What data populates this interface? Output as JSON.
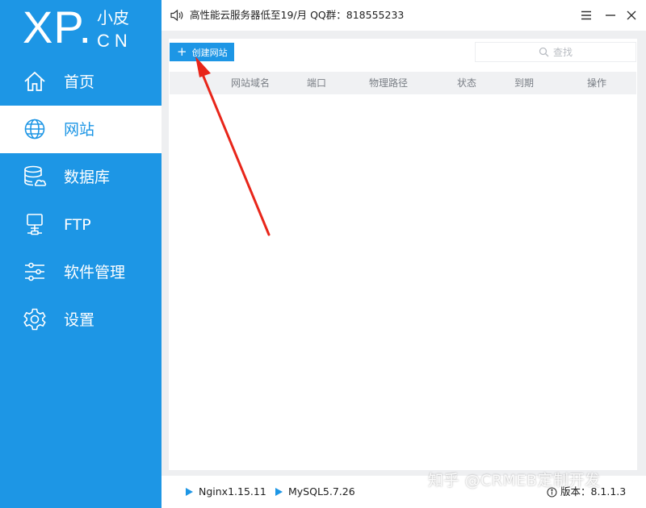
{
  "logo": {
    "mark": "XP.",
    "top": "小皮",
    "bottom": "CN"
  },
  "nav": [
    {
      "label": "首页",
      "icon": "home-icon",
      "active": false
    },
    {
      "label": "网站",
      "icon": "globe-icon",
      "active": true
    },
    {
      "label": "数据库",
      "icon": "database-icon",
      "active": false
    },
    {
      "label": "FTP",
      "icon": "ftp-icon",
      "active": false
    },
    {
      "label": "软件管理",
      "icon": "sliders-icon",
      "active": false
    },
    {
      "label": "设置",
      "icon": "gear-icon",
      "active": false
    }
  ],
  "topbar": {
    "notice": "高性能云服务器低至19/月  QQ群：818555233"
  },
  "toolbar": {
    "create_label": "创建网站",
    "search_label": "查找"
  },
  "table": {
    "columns": [
      "网站域名",
      "端口",
      "物理路径",
      "状态",
      "到期",
      "操作"
    ]
  },
  "footer": {
    "nginx": "Nginx1.15.11",
    "mysql": "MySQL5.7.26",
    "version": "版本：8.1.1.3"
  },
  "watermark": "知乎 @CRMEB定制开发",
  "colors": {
    "accent": "#1d96e5",
    "arrow": "#e8261a"
  }
}
